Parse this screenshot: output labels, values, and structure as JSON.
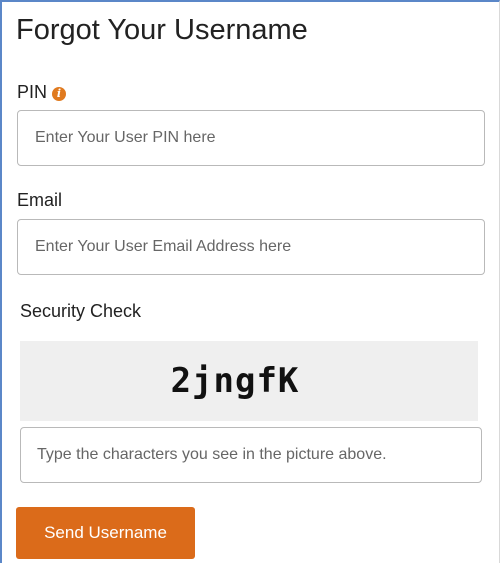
{
  "form": {
    "title": "Forgot Your Username",
    "pin": {
      "label": "PIN",
      "info_icon": "info-icon",
      "info_symbol": "i",
      "value": "",
      "placeholder": "Enter Your User PIN here"
    },
    "email": {
      "label": "Email",
      "value": "",
      "placeholder": "Enter Your User Email Address here"
    },
    "security": {
      "label": "Security Check",
      "captcha_text": "2jngfK",
      "value": "",
      "placeholder": "Type the characters you see in the picture above."
    },
    "submit_label": "Send Username"
  },
  "colors": {
    "accent": "#db6b1a",
    "info_icon": "#e07a1f",
    "captcha_bg": "#efefef",
    "input_border": "#b9b9b9"
  }
}
